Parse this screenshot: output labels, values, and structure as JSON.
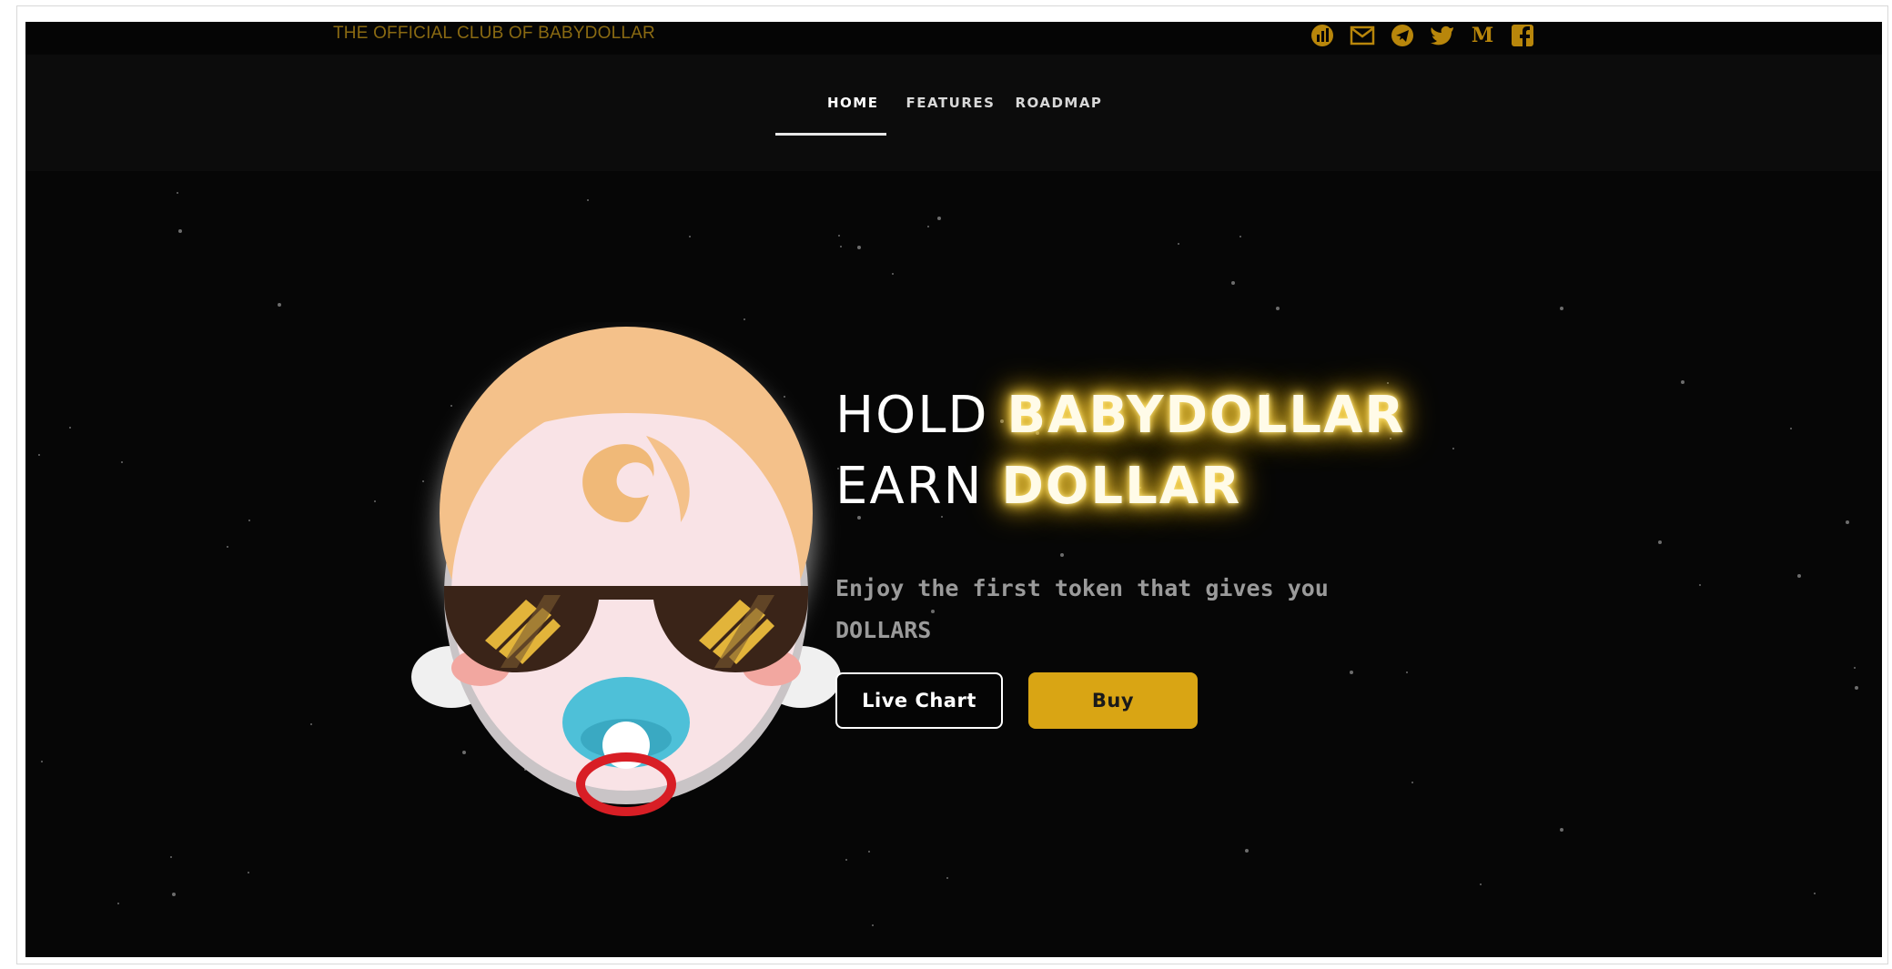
{
  "header": {
    "tagline": "THE OFFICIAL CLUB OF BABYDOLLAR",
    "socials": [
      {
        "icon": "chart-icon"
      },
      {
        "icon": "mail-icon"
      },
      {
        "icon": "telegram-icon"
      },
      {
        "icon": "twitter-icon"
      },
      {
        "icon": "medium-icon",
        "text": "M"
      },
      {
        "icon": "facebook-icon"
      }
    ]
  },
  "nav": {
    "items": [
      {
        "label": "HOME",
        "active": true
      },
      {
        "label": "FEATURES",
        "active": false
      },
      {
        "label": "ROADMAP",
        "active": false
      }
    ]
  },
  "hero": {
    "line1_prefix": "HOLD",
    "line1_highlight": "BABYDOLLAR",
    "line2_prefix": "EARN",
    "line2_highlight": "DOLLAR",
    "subtitle": "Enjoy the first token that gives you DOLLARS",
    "live_chart_label": "Live Chart",
    "buy_label": "Buy"
  },
  "colors": {
    "background": "#060606",
    "accent_gold": "#d9a514",
    "tagline_gold": "#8a6a12",
    "glow": "#ffd84a"
  }
}
